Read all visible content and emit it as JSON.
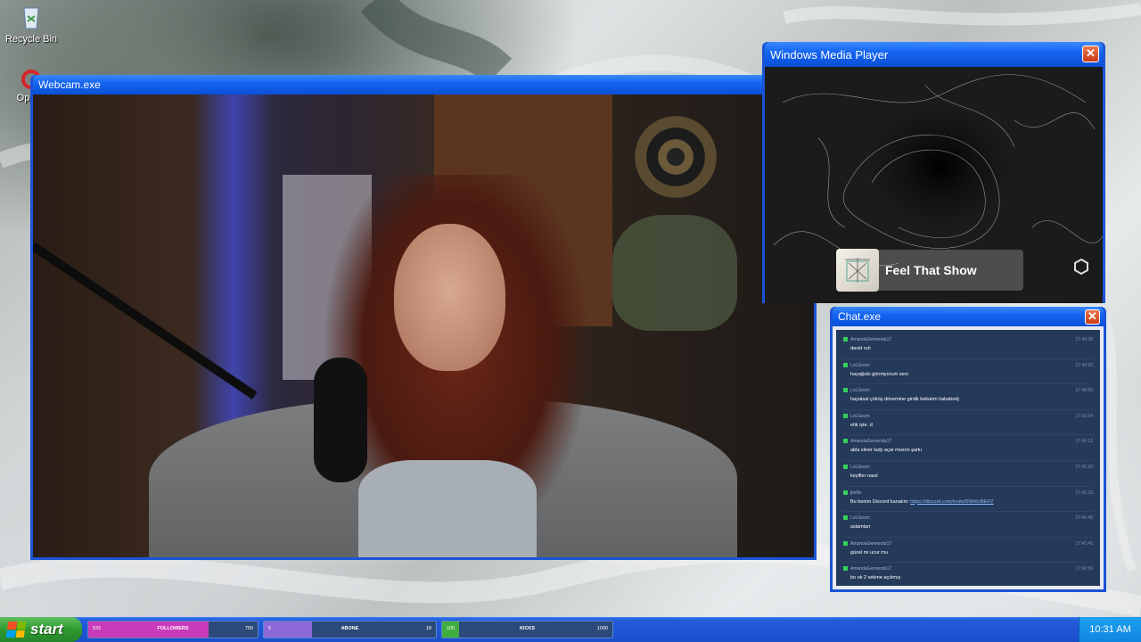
{
  "desktop": {
    "icons": [
      {
        "label": "Recycle Bin",
        "icon": "recycle-bin-icon"
      },
      {
        "label": "Op",
        "icon": "opera-icon"
      }
    ]
  },
  "webcam_window": {
    "title": "Webcam.exe",
    "icon": "close-icon"
  },
  "media_player": {
    "title": "Windows Media Player",
    "now_playing": "Feel That Show"
  },
  "chat_window": {
    "title": "Chat.exe",
    "messages": [
      {
        "user": "AmandaGemenda17",
        "time": "17:40:38",
        "text": "david ruh"
      },
      {
        "user": "LoLGezm",
        "time": "17:40:50",
        "text": "hayağıdo görmiyorum seni"
      },
      {
        "user": "LoLGezm",
        "time": "17:40:55",
        "text": "hayatsal çöküş dönemine girdik bekalım hababedj"
      },
      {
        "user": "LoLGezm",
        "time": "17:41:04",
        "text": "etik işte .d"
      },
      {
        "user": "AmandaGemenda17",
        "time": "17:41:12",
        "text": "abla silver lady açar mısınn şarkı"
      },
      {
        "user": "LoLGezm",
        "time": "17:41:20",
        "text": "keyifler nasıl"
      },
      {
        "user": "jkelfix",
        "time": "17:41:33",
        "text": "Bu benim Discord kanalım: ",
        "link": "https://discord.com/invite/5NhKnBEPZ"
      },
      {
        "user": "LoLGezm",
        "time": "17:41:40",
        "text": "aslamlarr"
      },
      {
        "user": "AmandaGemenda17",
        "time": "17:41:45",
        "text": "güzel mi ucur mu"
      },
      {
        "user": "AmandaGemenda17",
        "time": "17:41:50",
        "text": "bo ok 2 sekme açıkmış"
      }
    ]
  },
  "taskbar": {
    "start_label": "start",
    "goals": [
      {
        "label": "FOLLOWERS",
        "current": "532",
        "max": "750",
        "progress": 0.709,
        "color": "#c93bb8"
      },
      {
        "label": "ABONE",
        "current": "5",
        "max": "18",
        "progress": 0.28,
        "color": "#8c67d8"
      },
      {
        "label": "KICKS",
        "current": "100",
        "max": "1000",
        "progress": 0.1,
        "color": "#3fae3f"
      }
    ],
    "clock": "10:31 AM"
  }
}
